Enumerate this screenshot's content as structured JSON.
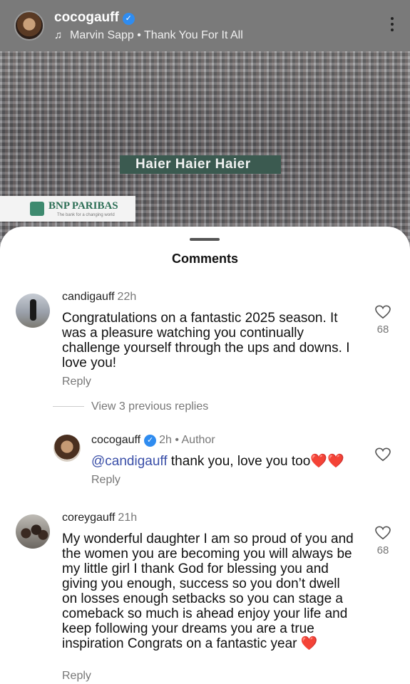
{
  "post": {
    "username": "cocogauff",
    "verified_mark": "✓",
    "music": "Marvin Sapp • Thank You For It All",
    "icons": {
      "music": "music-note-icon",
      "more": "more-vertical-icon"
    }
  },
  "photo": {
    "banner_haier": "Haier  Haier  Haier",
    "banner_bnp": "BNP PARIBAS",
    "banner_bnp_sub": "The bank for a changing world"
  },
  "comments_sheet": {
    "title": "Comments",
    "view_replies": "View 3 previous replies",
    "items": [
      {
        "username": "candigauff",
        "time": "22h",
        "text": "Congratulations on a fantastic 2025 season. It was a pleasure watching you continually challenge yourself through the ups and downs. I love you!",
        "reply_label": "Reply",
        "likes": "68"
      },
      {
        "username": "cocogauff",
        "time": "2h",
        "author_label": "• Author",
        "mention": "@candigauff",
        "text": " thank you, love you too",
        "hearts": "❤️❤️",
        "reply_label": "Reply"
      },
      {
        "username": "coreygauff",
        "time": "21h",
        "text": "My wonderful daughter I am so proud of you and the women you are becoming you will always be my little girl I thank God for blessing you and giving you enough, success so you don’t dwell on losses enough setbacks so you can stage a comeback so much is ahead enjoy your life and keep following your dreams  you are a true inspiration Congrats on a fantastic year",
        "heart": "❤️",
        "reply_label": "Reply",
        "likes": "68"
      }
    ]
  },
  "colors": {
    "mention": "#3a4fa8",
    "verified": "#2f8cf0",
    "muted": "#777777"
  }
}
